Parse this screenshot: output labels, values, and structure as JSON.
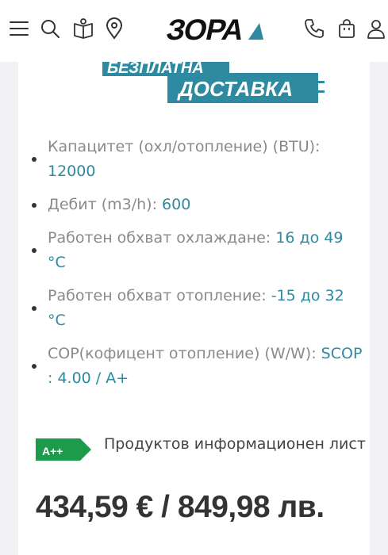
{
  "header": {
    "logo_text": "ЗОРА",
    "icons": [
      "menu-icon",
      "search-icon",
      "catalog-book-icon",
      "location-pin-icon",
      "phone-icon",
      "cart-bag-icon",
      "user-icon"
    ]
  },
  "banner": {
    "line1": "БЕЗПЛАТНА",
    "line2": "ДОСТАВКА",
    "color": "#2d8aa0"
  },
  "specs": [
    {
      "label": "Капацитет (охл/отопление) (BTU):",
      "value": "12000"
    },
    {
      "label": "Дебит (m3/h):",
      "value": "600"
    },
    {
      "label": "Работен обхват охлаждане:",
      "value": "16 до 49 °C"
    },
    {
      "label": "Работен обхват отопление:",
      "value": "-15 до 32 °C"
    },
    {
      "label": "COP(кофицент отопление) (W/W):",
      "value": "SCOP : 4.00 / A+"
    }
  ],
  "energy": {
    "label": "A++",
    "color": "#1e9a4b"
  },
  "info_link": "Продуктов информационен лист",
  "price": "434,59 € / 849,98 лв.",
  "colors": {
    "accent": "#2d8aa0",
    "text": "#333333",
    "muted": "#8a8a8a"
  }
}
